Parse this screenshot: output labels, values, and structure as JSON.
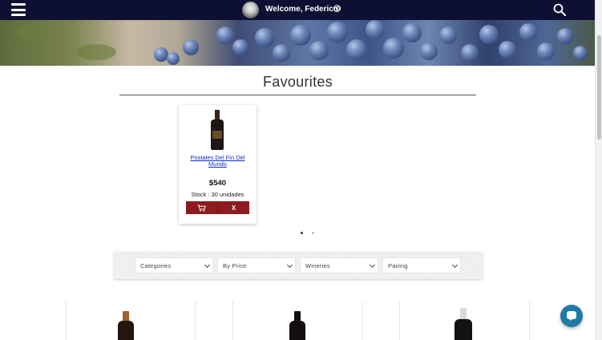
{
  "header": {
    "welcome_text": "Welcome, Federico",
    "menu_icon": "hamburger-menu-icon",
    "user_icon": "user-icon",
    "search_icon": "search-icon",
    "background_color": "#0d1033"
  },
  "favourites": {
    "title": "Favourites",
    "items": [
      {
        "name": "Postales Del Fin Del Mundo",
        "price": "$540",
        "stock": "Stock : 30 unidades",
        "cart_icon": "cart-icon",
        "remove_label": "X"
      }
    ],
    "carousel_dots": 2,
    "active_dot": 1
  },
  "filters": {
    "categories": "Categories",
    "price": "By Price",
    "wineries": "Wineries",
    "pairing": "Pairing"
  },
  "colors": {
    "accent": "#8e1b1f",
    "link": "#0a2bcc",
    "chat": "#1e7aa8"
  },
  "chat": {
    "icon": "chat-bubble-icon"
  }
}
